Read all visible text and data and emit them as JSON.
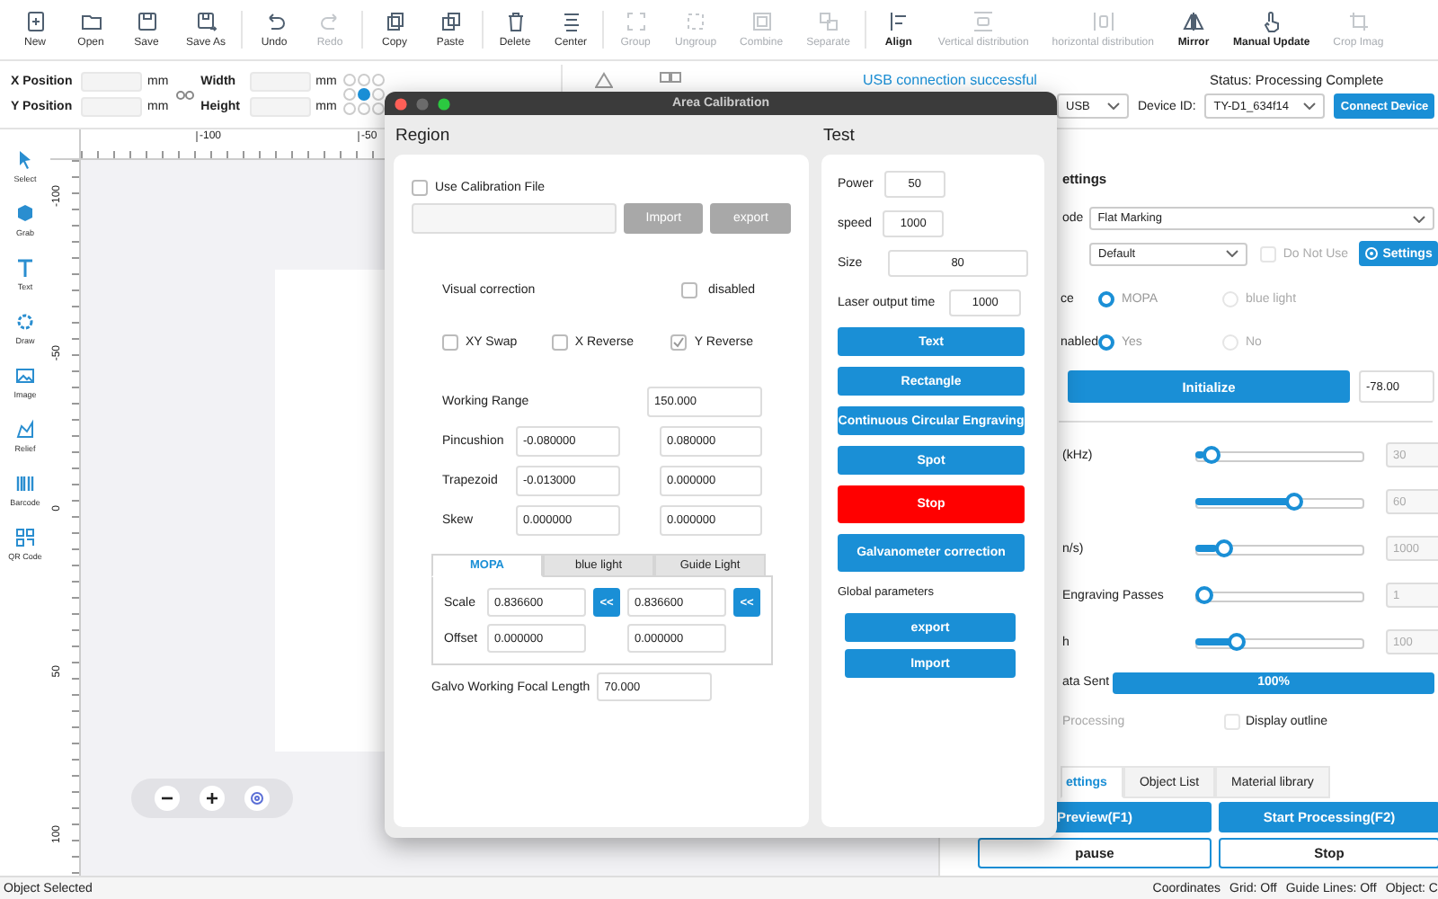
{
  "toolbar": [
    {
      "label": "New",
      "disabled": false
    },
    {
      "label": "Open",
      "disabled": false
    },
    {
      "label": "Save",
      "disabled": false
    },
    {
      "label": "Save As",
      "disabled": false
    },
    {
      "label": "Undo",
      "disabled": false
    },
    {
      "label": "Redo",
      "disabled": true
    },
    {
      "label": "Copy",
      "disabled": false
    },
    {
      "label": "Paste",
      "disabled": false
    },
    {
      "label": "Delete",
      "disabled": false
    },
    {
      "label": "Center",
      "disabled": false
    },
    {
      "label": "Group",
      "disabled": true
    },
    {
      "label": "Ungroup",
      "disabled": true
    },
    {
      "label": "Combine",
      "disabled": true
    },
    {
      "label": "Separate",
      "disabled": true
    },
    {
      "label": "Align",
      "disabled": false
    },
    {
      "label": "Vertical distribution",
      "disabled": true
    },
    {
      "label": "horizontal distribution",
      "disabled": true
    },
    {
      "label": "Mirror",
      "disabled": false
    },
    {
      "label": "Manual Update",
      "disabled": false
    },
    {
      "label": "Crop Imag",
      "disabled": true
    }
  ],
  "properties": {
    "x_label": "X Position",
    "y_label": "Y Position",
    "width_label": "Width",
    "height_label": "Height",
    "units": [
      "mm",
      "mm",
      "mm",
      "mm"
    ],
    "anchors": [
      {
        "selected": false
      },
      {
        "selected": false
      },
      {
        "selected": false
      },
      {
        "selected": false
      },
      {
        "selected": true
      },
      {
        "selected": false
      },
      {
        "selected": false
      },
      {
        "selected": false
      },
      {
        "selected": false
      }
    ]
  },
  "connection": {
    "message": "USB connection successful",
    "status": "Status: Processing Complete",
    "port": "USB",
    "device_label": "Device ID:",
    "device": "TY-D1_634f14",
    "connect_button": "Connect Device"
  },
  "tools": [
    "Select",
    "Grab",
    "Text",
    "Draw",
    "Image",
    "Relief",
    "Barcode",
    "QR Code"
  ],
  "rulers": {
    "horizontal": [
      "-100",
      "-50"
    ],
    "vertical": [
      "-100",
      "-50",
      "0",
      "50",
      "100"
    ]
  },
  "settings": {
    "title": "ettings",
    "mode_label": "ode",
    "mode": "Flat Marking",
    "preset": "Default",
    "do_not_use": {
      "label": "Do Not Use",
      "checked": false
    },
    "settings_button": "Settings",
    "source": {
      "label": "ce",
      "options": [
        {
          "label": "MOPA",
          "selected": true
        },
        {
          "label": "blue light",
          "selected": false
        }
      ]
    },
    "enabled": {
      "label": "nabled",
      "options": [
        {
          "label": "Yes",
          "selected": true
        },
        {
          "label": "No",
          "selected": false
        }
      ]
    },
    "initialize_button": "Initialize",
    "initialize_value": "-78.00",
    "sliders": [
      {
        "label": "(kHz)",
        "level": 0.05,
        "value": "30",
        "disabled": true
      },
      {
        "level": 0.6,
        "value": "60",
        "disabled": true
      },
      {
        "label": "n/s)",
        "level": 0.13,
        "value": "1000",
        "disabled": true
      },
      {
        "label": "Engraving Passes",
        "level": 0,
        "value": "1",
        "disabled": true
      },
      {
        "label": "h",
        "level": 0.22,
        "value": "100",
        "disabled": true
      }
    ],
    "data_sent": {
      "label": "ata Sent",
      "level": 1,
      "reading": "100%"
    },
    "processing": {
      "label": "Processing",
      "disabled": true
    },
    "display_outline": {
      "label": "Display outline",
      "checked": false
    }
  },
  "tabs": [
    {
      "label": "ettings",
      "selected": true
    },
    {
      "label": "Object List",
      "selected": false
    },
    {
      "label": "Material library",
      "selected": false
    }
  ],
  "actions": [
    "Preview(F1)",
    "Start Processing(F2)",
    "pause",
    "Stop"
  ],
  "dialog": {
    "title": "Area Calibration",
    "region": {
      "heading": "Region",
      "use_file": {
        "label": "Use Calibration File",
        "checked": false
      },
      "file_buttons": [
        {
          "label": "Import",
          "disabled": true
        },
        {
          "label": "export",
          "disabled": true
        }
      ],
      "visual_correction": {
        "label": "Visual correction",
        "checkbox_label": "disabled",
        "checked": false
      },
      "flags": [
        {
          "label": "XY Swap",
          "checked": false
        },
        {
          "label": "X Reverse",
          "checked": false
        },
        {
          "label": "Y Reverse",
          "checked": true
        }
      ],
      "params": [
        {
          "label": "Working Range",
          "values": [
            "150.000"
          ]
        },
        {
          "label": "Pincushion",
          "values": [
            "-0.080000",
            "0.080000"
          ]
        },
        {
          "label": "Trapezoid",
          "values": [
            "-0.013000",
            "0.000000"
          ]
        },
        {
          "label": "Skew",
          "values": [
            "0.000000",
            "0.000000"
          ]
        }
      ],
      "light_tabs": [
        {
          "label": "MOPA",
          "selected": true
        },
        {
          "label": "blue light",
          "selected": false
        },
        {
          "label": "Guide Light",
          "selected": false
        }
      ],
      "scale": {
        "label": "Scale",
        "values": [
          "0.836600",
          "0.836600"
        ],
        "buttons": [
          "<<",
          "<<"
        ]
      },
      "offset": {
        "label": "Offset",
        "values": [
          "0.000000",
          "0.000000"
        ]
      },
      "focal": {
        "label": "Galvo Working Focal Length",
        "value": "70.000"
      }
    },
    "test": {
      "heading": "Test",
      "fields": [
        {
          "label": "Power",
          "value": "50"
        },
        {
          "label": "speed",
          "value": "1000"
        },
        {
          "label": "Size",
          "value": "80"
        },
        {
          "label": "Laser output time",
          "value": "1000"
        }
      ],
      "buttons": [
        {
          "label": "Text",
          "kind": "normal"
        },
        {
          "label": "Rectangle",
          "kind": "normal"
        },
        {
          "label": "Continuous Circular Engraving",
          "kind": "normal"
        },
        {
          "label": "Spot",
          "kind": "normal"
        },
        {
          "label": "Stop",
          "kind": "danger"
        },
        {
          "label": "Galvanometer correction",
          "kind": "large"
        }
      ],
      "global_label": "Global parameters",
      "global_buttons": [
        "export",
        "Import"
      ]
    }
  },
  "status_bar": {
    "left": "Object Selected",
    "items": [
      "Coordinates",
      "Grid: Off",
      "Guide Lines: Off",
      "Object: C"
    ]
  }
}
